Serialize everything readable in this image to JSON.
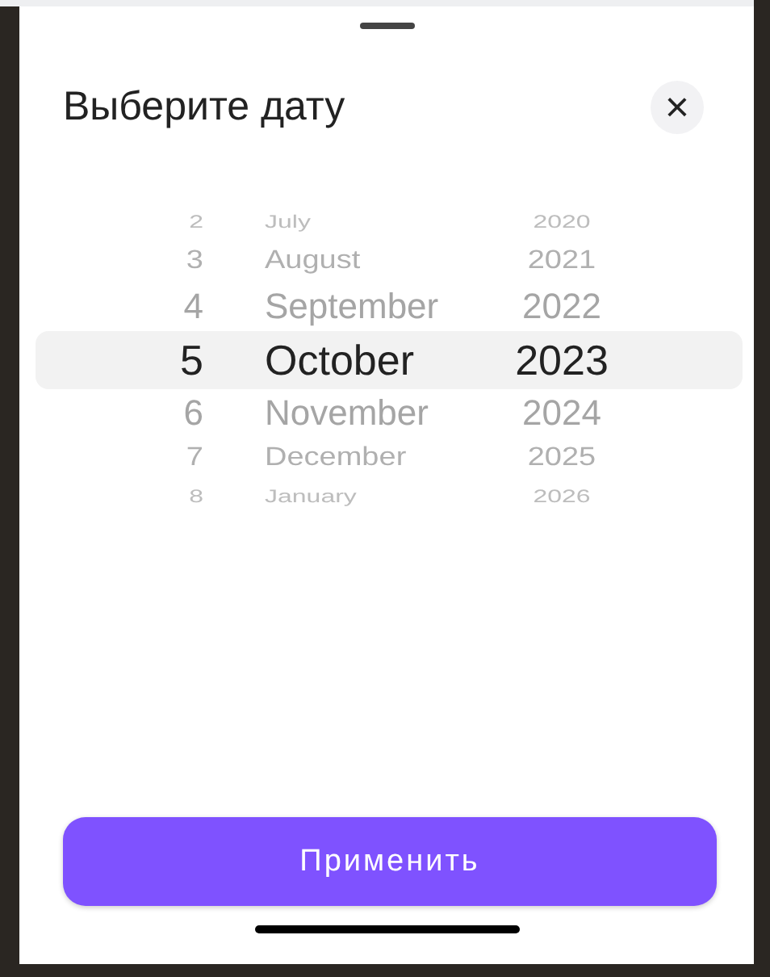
{
  "sheet": {
    "title": "Выберите дату",
    "close_label": "×"
  },
  "picker": {
    "days": [
      {
        "label": "2",
        "selected": false
      },
      {
        "label": "3",
        "selected": false
      },
      {
        "label": "4",
        "selected": false
      },
      {
        "label": "5",
        "selected": true
      },
      {
        "label": "6",
        "selected": false
      },
      {
        "label": "7",
        "selected": false
      },
      {
        "label": "8",
        "selected": false
      }
    ],
    "months": [
      {
        "label": "July",
        "selected": false
      },
      {
        "label": "August",
        "selected": false
      },
      {
        "label": "September",
        "selected": false
      },
      {
        "label": "October",
        "selected": true
      },
      {
        "label": "November",
        "selected": false
      },
      {
        "label": "December",
        "selected": false
      },
      {
        "label": "January",
        "selected": false
      }
    ],
    "years": [
      {
        "label": "2020",
        "selected": false
      },
      {
        "label": "2021",
        "selected": false
      },
      {
        "label": "2022",
        "selected": false
      },
      {
        "label": "2023",
        "selected": true
      },
      {
        "label": "2024",
        "selected": false
      },
      {
        "label": "2025",
        "selected": false
      },
      {
        "label": "2026",
        "selected": false
      }
    ]
  },
  "apply_button": "Применить"
}
